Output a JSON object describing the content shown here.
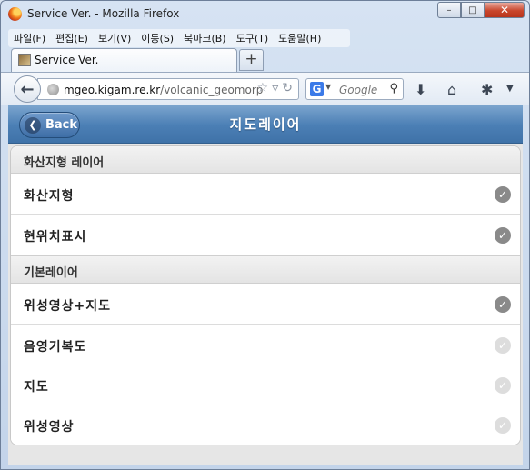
{
  "window": {
    "title": "Service Ver. - Mozilla Firefox",
    "min": "–",
    "max": "□",
    "close": "✕"
  },
  "menubar": {
    "items": [
      "파일(F)",
      "편집(E)",
      "보기(V)",
      "이동(S)",
      "북마크(B)",
      "도구(T)",
      "도움말(H)"
    ]
  },
  "tab": {
    "title": "Service Ver.",
    "new_tab": "+"
  },
  "navbar": {
    "url_host": "mgeo.kigam.re.kr",
    "url_path": "/volcanic_geomorp",
    "search_engine": "G",
    "search_placeholder": "Google",
    "icons": [
      "back-arrow-icon",
      "globe-icon",
      "bookmark-star-icon",
      "dropdown-icon",
      "reload-icon",
      "search-icon",
      "download-icon",
      "home-icon",
      "addon-icon",
      "menu-icon"
    ]
  },
  "header": {
    "back_label": "Back",
    "title": "지도레이어"
  },
  "list": {
    "groups": [
      {
        "label": "화산지형 레이어",
        "items": [
          {
            "label": "화산지형",
            "checked": true
          },
          {
            "label": "현위치표시",
            "checked": true
          }
        ]
      },
      {
        "label": "기본레이어",
        "items": [
          {
            "label": "위성영상+지도",
            "checked": true
          },
          {
            "label": "음영기복도",
            "checked": false
          },
          {
            "label": "지도",
            "checked": false
          },
          {
            "label": "위성영상",
            "checked": false
          }
        ]
      }
    ]
  },
  "colors": {
    "header": "#4b7fb5",
    "check_on": "#8a8a8a",
    "check_off": "#dddddd"
  }
}
